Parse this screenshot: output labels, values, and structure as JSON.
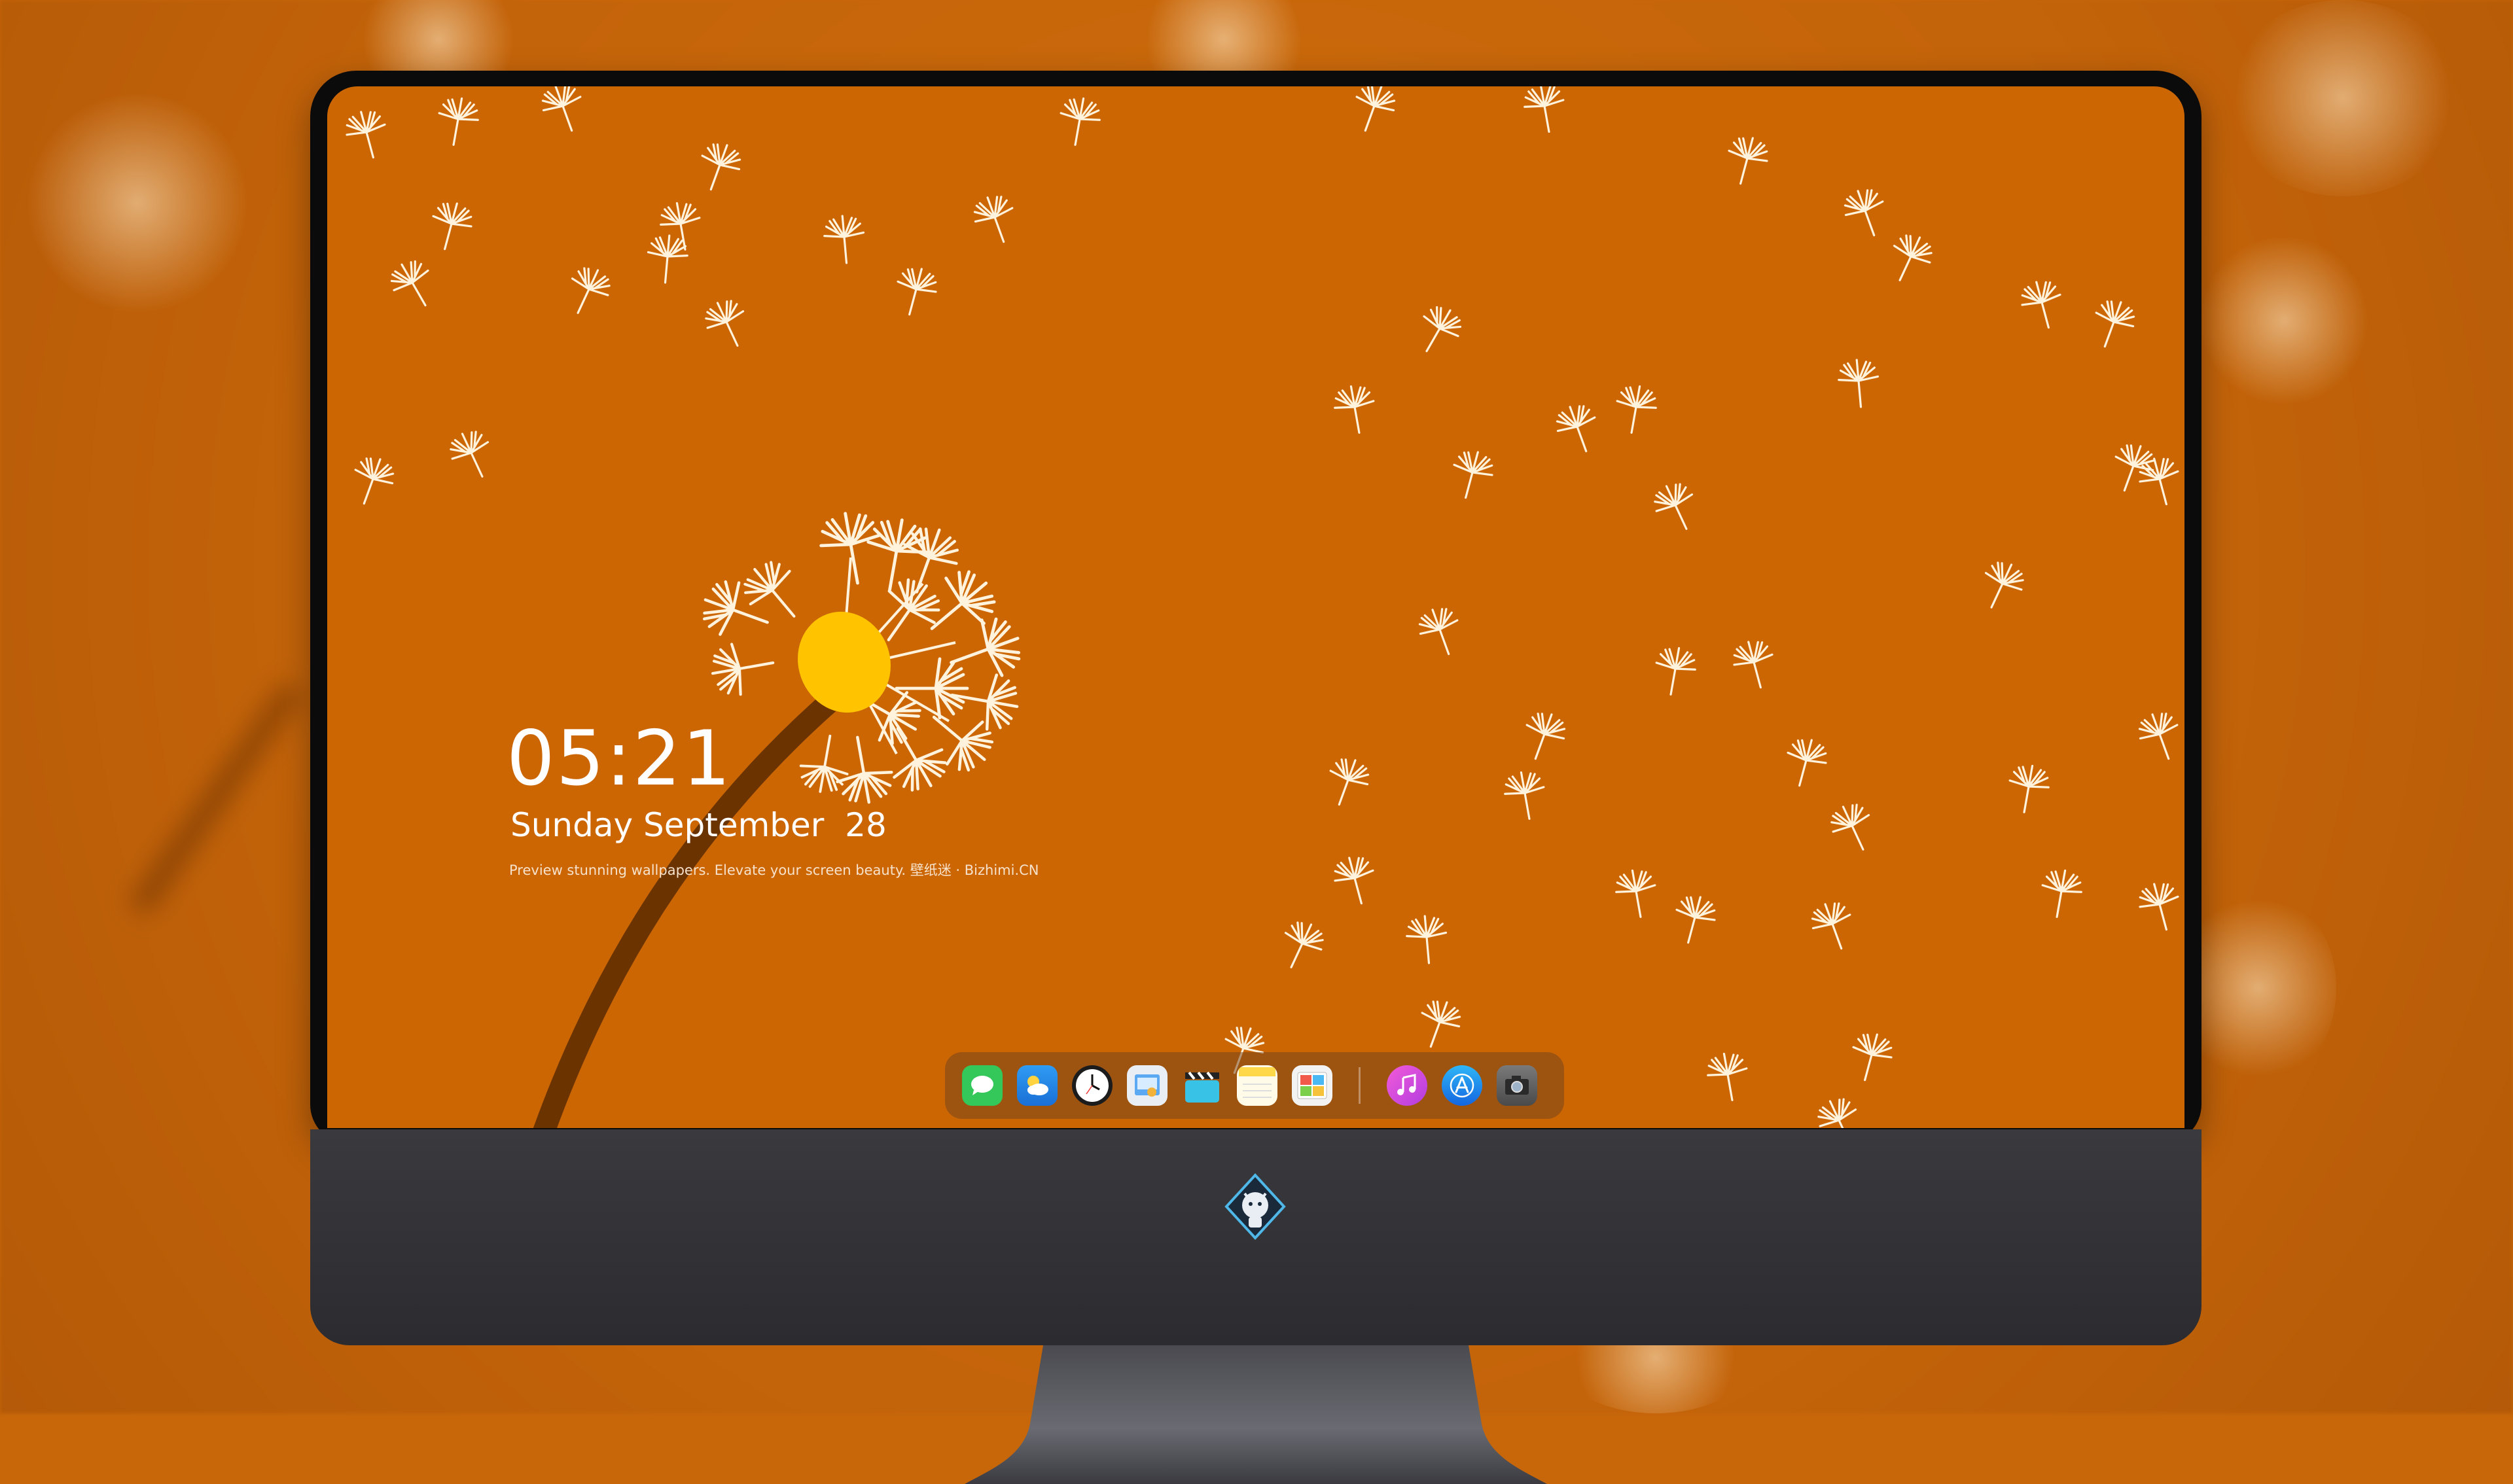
{
  "desktop": {
    "clock": "05:21",
    "date": "Sunday September  28",
    "tagline": "Preview stunning wallpapers. Elevate your screen beauty. 壁纸迷 · Bizhimi.CN"
  },
  "dock": {
    "apps": [
      {
        "name": "messages",
        "icon": "messages-icon",
        "color": "#34c759"
      },
      {
        "name": "weather",
        "icon": "weather-icon",
        "color": "#1e8cf0"
      },
      {
        "name": "clock",
        "icon": "clock-icon",
        "color": "#ffffff"
      },
      {
        "name": "preview",
        "icon": "preview-icon",
        "color": "#4aa3f0"
      },
      {
        "name": "video",
        "icon": "clapper-icon",
        "color": "#2fbfe0"
      },
      {
        "name": "notes",
        "icon": "notes-icon",
        "color": "#ffd84a"
      },
      {
        "name": "photo-booth",
        "icon": "photo-booth-icon",
        "color": "#e84b4b"
      },
      {
        "name": "music",
        "icon": "music-icon",
        "color": "#e43fd0"
      },
      {
        "name": "app-store",
        "icon": "app-store-icon",
        "color": "#1f8df0"
      },
      {
        "name": "camera",
        "icon": "camera-icon",
        "color": "#5a5a5a"
      }
    ]
  },
  "colors": {
    "wallpaper": "#cc6603",
    "flower_center": "#ffc300",
    "seed": "#fff3dd",
    "stem": "#6a3300"
  }
}
